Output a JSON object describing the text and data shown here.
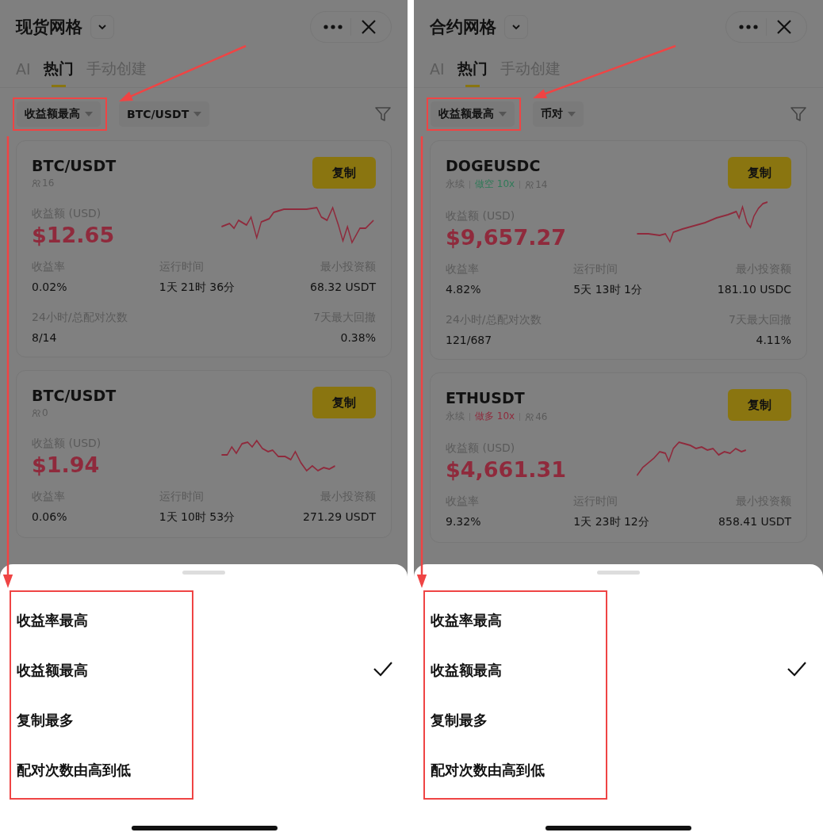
{
  "panels": [
    {
      "title": "现货网格",
      "tabs": [
        {
          "label": "AI",
          "selected": false
        },
        {
          "label": "热门",
          "selected": true
        },
        {
          "label": "手动创建",
          "selected": false
        }
      ],
      "filters": [
        {
          "label": "收益额最高",
          "highlighted": true
        },
        {
          "label": "BTC/USDT",
          "highlighted": false
        }
      ],
      "cards": [
        {
          "pair": "BTC/USDT",
          "tags": [
            {
              "kind": "followers",
              "text": "16"
            }
          ],
          "profit_label": "收益额 (USD)",
          "profit": "$12.65",
          "copy_button": "复制",
          "stats": [
            [
              {
                "label": "收益率",
                "value": "0.02%"
              },
              {
                "label": "运行时间",
                "value": "1天 21时 36分"
              },
              {
                "label": "最小投资额",
                "value": "68.32 USDT"
              }
            ],
            [
              {
                "label": "24小时/总配对次数",
                "value": "8/14"
              },
              {
                "label": "7天最大回撤",
                "value": "0.38%"
              }
            ]
          ]
        },
        {
          "pair": "BTC/USDT",
          "tags": [
            {
              "kind": "followers",
              "text": "0"
            }
          ],
          "profit_label": "收益额 (USD)",
          "profit": "$1.94",
          "copy_button": "复制",
          "stats": [
            [
              {
                "label": "收益率",
                "value": "0.06%"
              },
              {
                "label": "运行时间",
                "value": "1天 10时 53分"
              },
              {
                "label": "最小投资额",
                "value": "271.29 USDT"
              }
            ]
          ]
        }
      ],
      "sheet": {
        "options": [
          {
            "label": "收益率最高",
            "selected": false
          },
          {
            "label": "收益额最高",
            "selected": true
          },
          {
            "label": "复制最多",
            "selected": false
          },
          {
            "label": "配对次数由高到低",
            "selected": false
          }
        ]
      }
    },
    {
      "title": "合约网格",
      "tabs": [
        {
          "label": "AI",
          "selected": false
        },
        {
          "label": "热门",
          "selected": true
        },
        {
          "label": "手动创建",
          "selected": false
        }
      ],
      "filters": [
        {
          "label": "收益额最高",
          "highlighted": true
        },
        {
          "label": "币对",
          "highlighted": false
        }
      ],
      "cards": [
        {
          "pair": "DOGEUSDC",
          "tags": [
            {
              "kind": "plain",
              "text": "永续"
            },
            {
              "kind": "direction",
              "text": "做空 10x",
              "color": "#2f7a58"
            },
            {
              "kind": "followers",
              "text": "14"
            }
          ],
          "profit_label": "收益额 (USD)",
          "profit": "$9,657.27",
          "copy_button": "复制",
          "stats": [
            [
              {
                "label": "收益率",
                "value": "4.82%"
              },
              {
                "label": "运行时间",
                "value": "5天 13时 1分"
              },
              {
                "label": "最小投资额",
                "value": "181.10 USDC"
              }
            ],
            [
              {
                "label": "24小时/总配对次数",
                "value": "121/687"
              },
              {
                "label": "7天最大回撤",
                "value": "4.11%"
              }
            ]
          ]
        },
        {
          "pair": "ETHUSDT",
          "tags": [
            {
              "kind": "plain",
              "text": "永续"
            },
            {
              "kind": "direction",
              "text": "做多 10x",
              "color": "#8f2a3c"
            },
            {
              "kind": "followers",
              "text": "46"
            }
          ],
          "profit_label": "收益额 (USD)",
          "profit": "$4,661.31",
          "copy_button": "复制",
          "stats": [
            [
              {
                "label": "收益率",
                "value": "9.32%"
              },
              {
                "label": "运行时间",
                "value": "1天 23时 12分"
              },
              {
                "label": "最小投资额",
                "value": "858.41 USDT"
              }
            ]
          ]
        }
      ],
      "sheet": {
        "options": [
          {
            "label": "收益率最高",
            "selected": false
          },
          {
            "label": "收益额最高",
            "selected": true
          },
          {
            "label": "复制最多",
            "selected": false
          },
          {
            "label": "配对次数由高到低",
            "selected": false
          }
        ]
      }
    }
  ]
}
